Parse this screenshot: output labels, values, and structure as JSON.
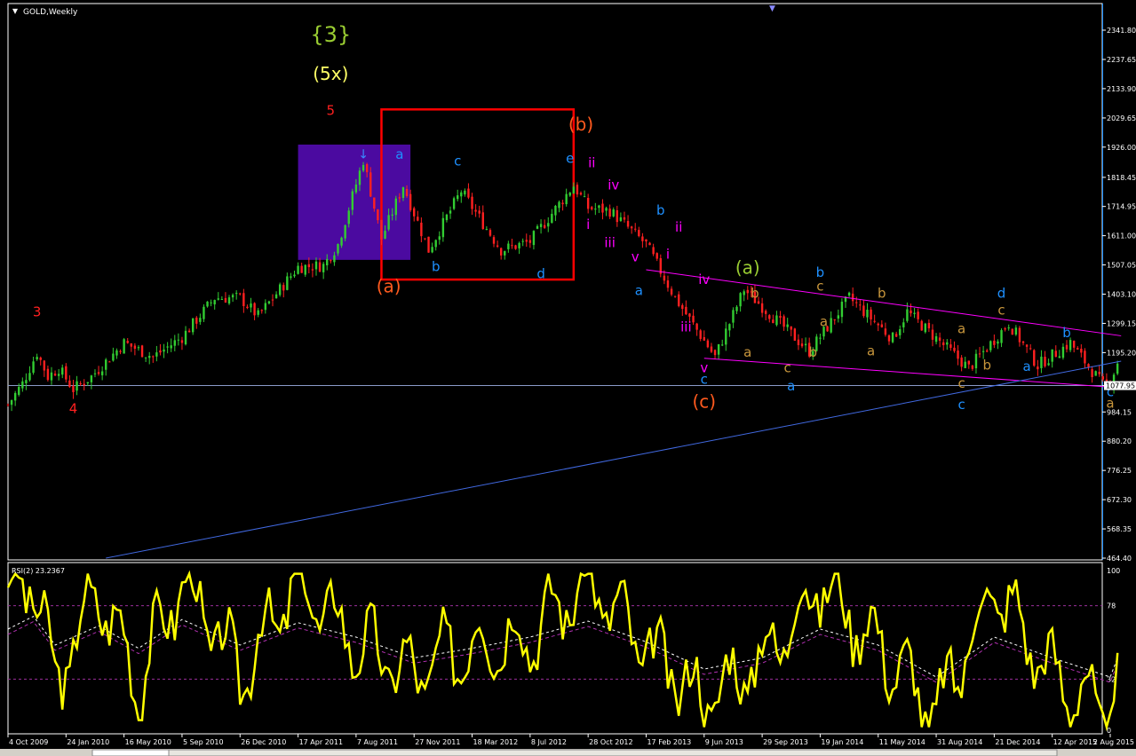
{
  "window": {
    "symbol_label": "GOLD,Weekly",
    "menu_arrow": "triangle-down-icon"
  },
  "colors": {
    "background": "#000000",
    "frame": "#ffffff",
    "bull_candle": "#32cd32",
    "bear_candle": "#ff2020",
    "label_red": "#ff2020",
    "label_orange": "#ff5a1e",
    "label_cyan": "#1e90ff",
    "label_magenta": "#ff00ff",
    "label_yellow": "#ffff66",
    "label_olive": "#9acd32",
    "label_brown": "#c8963c",
    "trend_magenta": "#ff00ff",
    "trend_blue": "#4169e1",
    "highlight_purple": "#4b0aa0",
    "box_red": "#ff0000",
    "rsi_line": "#ffff00",
    "rsi_ma": "#ffffff",
    "rsi_levels": "#9b2f9b"
  },
  "chart_data": [
    {
      "type": "candlestick",
      "title": "GOLD,Weekly",
      "ylim": [
        464.4,
        2341.8
      ],
      "y_ticks": [
        "2341.80",
        "2237.65",
        "2133.90",
        "2029.65",
        "1926.00",
        "1818.45",
        "1714.95",
        "1611.00",
        "1507.05",
        "1403.10",
        "1299.15",
        "1195.20",
        "1077.95",
        "984.15",
        "880.20",
        "776.25",
        "672.30",
        "568.35",
        "464.40"
      ],
      "current_price_label": "1077.95",
      "x_tick_labels": [
        "4 Oct 2009",
        "24 Jan 2010",
        "16 May 2010",
        "5 Sep 2010",
        "26 Dec 2010",
        "17 Apr 2011",
        "7 Aug 2011",
        "27 Nov 2011",
        "18 Mar 2012",
        "8 Jul 2012",
        "28 Oct 2012",
        "17 Feb 2013",
        "9 Jun 2013",
        "29 Sep 2013",
        "19 Jan 2014",
        "11 May 2014",
        "31 Aug 2014",
        "21 Dec 2014",
        "12 Apr 2015",
        "2 Aug 2015"
      ],
      "close_path": [
        {
          "date": "4 Oct 2009",
          "price": 1010
        },
        {
          "date": "1 Nov 2009",
          "price": 1085
        },
        {
          "date": "29 Nov 2009",
          "price": 1195
        },
        {
          "date": "20 Dec 2009",
          "price": 1110
        },
        {
          "date": "10 Jan 2010",
          "price": 1140
        },
        {
          "date": "7 Feb 2010",
          "price": 1065
        },
        {
          "date": "14 Mar 2010",
          "price": 1110
        },
        {
          "date": "16 May 2010",
          "price": 1230
        },
        {
          "date": "11 Jul 2010",
          "price": 1180
        },
        {
          "date": "5 Sep 2010",
          "price": 1250
        },
        {
          "date": "7 Nov 2010",
          "price": 1390
        },
        {
          "date": "26 Dec 2010",
          "price": 1390
        },
        {
          "date": "30 Jan 2011",
          "price": 1325
        },
        {
          "date": "17 Apr 2011",
          "price": 1500
        },
        {
          "date": "5 Jun 2011",
          "price": 1505
        },
        {
          "date": "3 Jul 2011",
          "price": 1580
        },
        {
          "date": "21 Aug 2011",
          "price": 1880
        },
        {
          "date": "25 Sep 2011",
          "price": 1600
        },
        {
          "date": "6 Nov 2011",
          "price": 1790
        },
        {
          "date": "25 Dec 2011",
          "price": 1560
        },
        {
          "date": "26 Feb 2012",
          "price": 1770
        },
        {
          "date": "13 May 2012",
          "price": 1560
        },
        {
          "date": "8 Jul 2012",
          "price": 1590
        },
        {
          "date": "30 Sep 2012",
          "price": 1790
        },
        {
          "date": "28 Oct 2012",
          "price": 1710
        },
        {
          "date": "9 Dec 2012",
          "price": 1700
        },
        {
          "date": "17 Feb 2013",
          "price": 1580
        },
        {
          "date": "14 Apr 2013",
          "price": 1390
        },
        {
          "date": "30 Jun 2013",
          "price": 1180
        },
        {
          "date": "25 Aug 2013",
          "price": 1420
        },
        {
          "date": "29 Dec 2013",
          "price": 1200
        },
        {
          "date": "16 Mar 2014",
          "price": 1390
        },
        {
          "date": "8 Jun 2014",
          "price": 1245
        },
        {
          "date": "6 Jul 2014",
          "price": 1340
        },
        {
          "date": "2 Nov 2014",
          "price": 1140
        },
        {
          "date": "18 Jan 2015",
          "price": 1300
        },
        {
          "date": "15 Mar 2015",
          "price": 1150
        },
        {
          "date": "17 May 2015",
          "price": 1230
        },
        {
          "date": "19 Jul 2015",
          "price": 1080
        },
        {
          "date": "2 Aug 2015",
          "price": 1095
        },
        {
          "date": "16 Aug 2015",
          "price": 1160
        }
      ],
      "reference_levels": [
        {
          "price": 1077.95
        }
      ],
      "trendlines": [
        {
          "color": "magenta",
          "from": {
            "date": "17 Feb 2013",
            "price": 1490
          },
          "to": {
            "date": "23 Aug 2015",
            "price": 1255
          }
        },
        {
          "color": "magenta",
          "from": {
            "date": "9 Jun 2013",
            "price": 1175
          },
          "to": {
            "date": "23 Aug 2015",
            "price": 1070
          }
        },
        {
          "color": "blue",
          "from": {
            "date": "11 Apr 2010",
            "price": 464.4
          },
          "to": {
            "date": "23 Aug 2015",
            "price": 1165
          }
        }
      ],
      "wave_labels": [
        {
          "text": "{3}",
          "date": "19 Jun 2011",
          "price": 2300,
          "color": "olive"
        },
        {
          "text": "(5x)",
          "date": "19 Jun 2011",
          "price": 2165,
          "color": "yellow"
        },
        {
          "text": "5",
          "date": "19 Jun 2011",
          "price": 2040,
          "color": "red"
        },
        {
          "text": "3",
          "date": "29 Nov 2009",
          "price": 1325,
          "color": "red"
        },
        {
          "text": "4",
          "date": "7 Feb 2010",
          "price": 980,
          "color": "red"
        },
        {
          "text": "a",
          "date": "30 Oct 2011",
          "price": 1885,
          "color": "cyan"
        },
        {
          "text": "b",
          "date": "8 Jan 2012",
          "price": 1485,
          "color": "cyan"
        },
        {
          "text": "(a)",
          "date": "9 Oct 2011",
          "price": 1410,
          "color": "orange"
        },
        {
          "text": "c",
          "date": "19 Feb 2012",
          "price": 1860,
          "color": "cyan"
        },
        {
          "text": "d",
          "date": "29 Jul 2012",
          "price": 1460,
          "color": "cyan"
        },
        {
          "text": "(b)",
          "date": "14 Oct 2012",
          "price": 1985,
          "color": "orange"
        },
        {
          "text": "e",
          "date": "23 Sep 2012",
          "price": 1870,
          "color": "cyan"
        },
        {
          "text": "ii",
          "date": "4 Nov 2012",
          "price": 1855,
          "color": "magenta"
        },
        {
          "text": "i",
          "date": "28 Oct 2012",
          "price": 1635,
          "color": "magenta"
        },
        {
          "text": "iv",
          "date": "16 Dec 2012",
          "price": 1775,
          "color": "magenta"
        },
        {
          "text": "iii",
          "date": "9 Dec 2012",
          "price": 1570,
          "color": "magenta"
        },
        {
          "text": "v",
          "date": "27 Jan 2013",
          "price": 1520,
          "color": "magenta"
        },
        {
          "text": "a",
          "date": "3 Feb 2013",
          "price": 1400,
          "color": "cyan"
        },
        {
          "text": "b",
          "date": "17 Mar 2013",
          "price": 1685,
          "color": "cyan"
        },
        {
          "text": "ii",
          "date": "21 Apr 2013",
          "price": 1625,
          "color": "magenta"
        },
        {
          "text": "i",
          "date": "31 Mar 2013",
          "price": 1530,
          "color": "magenta"
        },
        {
          "text": "iv",
          "date": "9 Jun 2013",
          "price": 1440,
          "color": "magenta"
        },
        {
          "text": "iii",
          "date": "5 May 2013",
          "price": 1270,
          "color": "magenta"
        },
        {
          "text": "v",
          "date": "9 Jun 2013",
          "price": 1125,
          "color": "magenta"
        },
        {
          "text": "c",
          "date": "9 Jun 2013",
          "price": 1085,
          "color": "cyan"
        },
        {
          "text": "(c)",
          "date": "9 Jun 2013",
          "price": 1000,
          "color": "orange"
        },
        {
          "text": "(a)",
          "date": "1 Sep 2013",
          "price": 1475,
          "color": "olive"
        },
        {
          "text": "b",
          "date": "15 Sep 2013",
          "price": 1390,
          "color": "brown"
        },
        {
          "text": "a",
          "date": "1 Sep 2013",
          "price": 1180,
          "color": "brown"
        },
        {
          "text": "a",
          "date": "26 Jan 2014",
          "price": 1290,
          "color": "brown"
        },
        {
          "text": "b",
          "date": "5 Jan 2014",
          "price": 1180,
          "color": "brown"
        },
        {
          "text": "c",
          "date": "17 Nov 2013",
          "price": 1125,
          "color": "brown"
        },
        {
          "text": "a",
          "date": "24 Nov 2013",
          "price": 1060,
          "color": "cyan"
        },
        {
          "text": "b",
          "date": "19 Jan 2014",
          "price": 1465,
          "color": "cyan"
        },
        {
          "text": "c",
          "date": "19 Jan 2014",
          "price": 1415,
          "color": "brown"
        },
        {
          "text": "b",
          "date": "18 May 2014",
          "price": 1390,
          "color": "brown"
        },
        {
          "text": "a",
          "date": "27 Apr 2014",
          "price": 1185,
          "color": "brown"
        },
        {
          "text": "a",
          "date": "19 Oct 2014",
          "price": 1265,
          "color": "brown"
        },
        {
          "text": "b",
          "date": "7 Dec 2014",
          "price": 1135,
          "color": "brown"
        },
        {
          "text": "c",
          "date": "19 Oct 2014",
          "price": 1070,
          "color": "brown"
        },
        {
          "text": "c",
          "date": "19 Oct 2014",
          "price": 995,
          "color": "cyan"
        },
        {
          "text": "d",
          "date": "4 Jan 2015",
          "price": 1390,
          "color": "cyan"
        },
        {
          "text": "c",
          "date": "4 Jan 2015",
          "price": 1330,
          "color": "brown"
        },
        {
          "text": "b",
          "date": "10 May 2015",
          "price": 1250,
          "color": "cyan"
        },
        {
          "text": "a",
          "date": "22 Feb 2015",
          "price": 1130,
          "color": "cyan"
        },
        {
          "text": "c",
          "date": "2 Aug 2015",
          "price": 1040,
          "color": "cyan"
        },
        {
          "text": "a",
          "date": "2 Aug 2015",
          "price": 1000,
          "color": "brown"
        }
      ],
      "rectangles": [
        {
          "label": "purple-zone",
          "color": "purple",
          "from_date": "17 Apr 2011",
          "to_date": "20 Nov 2011",
          "price_top": 1935,
          "price_bottom": 1525
        },
        {
          "label": "red-box",
          "color": "red",
          "from_date": "25 Sep 2011",
          "to_date": "30 Sep 2012",
          "price_top": 2060,
          "price_bottom": 1455
        }
      ]
    },
    {
      "type": "line",
      "title": "RSI(2) 23.2367",
      "ylim": [
        0,
        100
      ],
      "y_ticks": [
        100,
        78,
        32,
        0
      ],
      "levels": [
        78,
        32
      ],
      "series": [
        {
          "x": [
            "4 Oct 2009",
            "22 Nov 2009",
            "3 Jan 2010",
            "28 Mar 2010",
            "13 Jun 2010",
            "5 Sep 2010",
            "26 Dec 2010",
            "17 Apr 2011",
            "7 Aug 2011",
            "27 Nov 2011",
            "18 Mar 2012",
            "8 Jul 2012",
            "28 Oct 2012",
            "17 Feb 2013",
            "9 Jun 2013",
            "29 Sep 2013",
            "19 Jan 2014",
            "11 May 2014",
            "31 Aug 2014",
            "21 Dec 2014",
            "12 Apr 2015",
            "2 Aug 2015",
            "16 Aug 2015"
          ],
          "values": [
            84,
            95,
            30,
            88,
            30,
            95,
            35,
            93,
            55,
            35,
            55,
            60,
            95,
            50,
            20,
            45,
            92,
            55,
            10,
            90,
            35,
            10,
            52
          ]
        }
      ],
      "ma_values": [
        60,
        68,
        50,
        62,
        48,
        66,
        50,
        64,
        55,
        42,
        48,
        55,
        65,
        52,
        35,
        42,
        60,
        50,
        30,
        55,
        42,
        30,
        42
      ]
    }
  ]
}
